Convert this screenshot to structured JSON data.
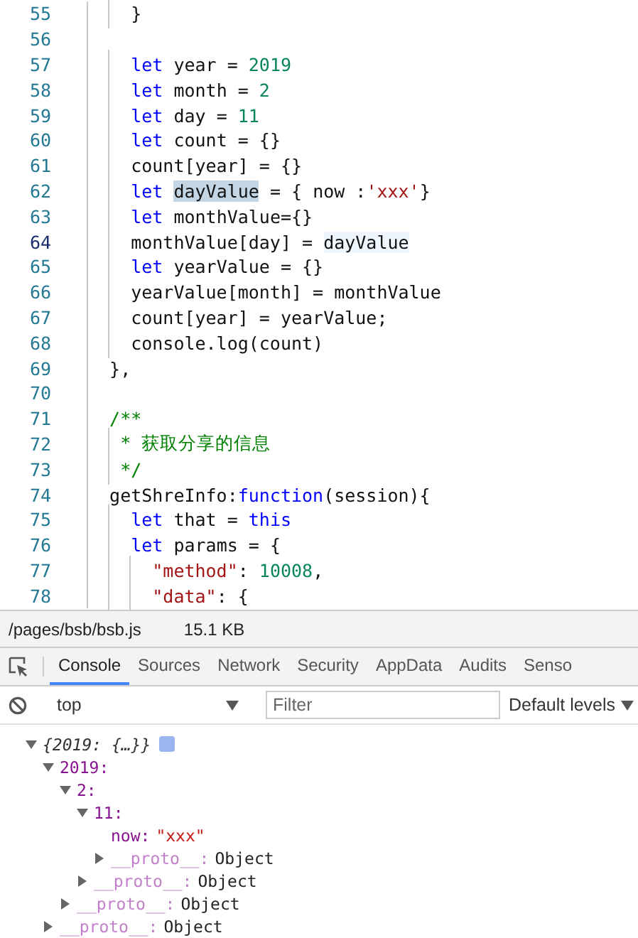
{
  "editor": {
    "lines": [
      {
        "number": "55",
        "current": false,
        "tokens": [
          {
            "kind": "plain",
            "text": "    }"
          }
        ]
      },
      {
        "number": "56",
        "current": false
      },
      {
        "number": "57",
        "current": false,
        "tokens": [
          {
            "kind": "keyword",
            "text": "    let"
          },
          {
            "kind": "plain",
            "text": " year = "
          },
          {
            "kind": "number",
            "text": "2019"
          }
        ]
      },
      {
        "number": "58",
        "current": false,
        "tokens": [
          {
            "kind": "keyword",
            "text": "    let"
          },
          {
            "kind": "plain",
            "text": " month = "
          },
          {
            "kind": "number",
            "text": "2"
          }
        ]
      },
      {
        "number": "59",
        "current": false,
        "tokens": [
          {
            "kind": "keyword",
            "text": "    let"
          },
          {
            "kind": "plain",
            "text": " day = "
          },
          {
            "kind": "number",
            "text": "11"
          }
        ]
      },
      {
        "number": "60",
        "current": false,
        "tokens": [
          {
            "kind": "keyword",
            "text": "    let"
          },
          {
            "kind": "plain",
            "text": " count = {}"
          }
        ]
      },
      {
        "number": "61",
        "current": false,
        "tokens": [
          {
            "kind": "plain",
            "text": "    count[year] = {}"
          }
        ]
      },
      {
        "number": "62",
        "current": false,
        "tokens": [
          {
            "kind": "keyword",
            "text": "    let "
          },
          {
            "kind": "selection",
            "text": "dayValue"
          },
          {
            "kind": "plain",
            "text": " = { now :"
          },
          {
            "kind": "string",
            "text": "'xxx'"
          },
          {
            "kind": "plain",
            "text": "}"
          }
        ]
      },
      {
        "number": "63",
        "current": false,
        "tokens": [
          {
            "kind": "keyword",
            "text": "    let"
          },
          {
            "kind": "plain",
            "text": " monthValue={}"
          }
        ]
      },
      {
        "number": "64",
        "current": true,
        "tokens": [
          {
            "kind": "plain",
            "text": "    monthValue[day] = "
          },
          {
            "kind": "match",
            "text": "dayValue"
          }
        ]
      },
      {
        "number": "65",
        "current": false,
        "tokens": [
          {
            "kind": "keyword",
            "text": "    let"
          },
          {
            "kind": "plain",
            "text": " yearValue = {}"
          }
        ]
      },
      {
        "number": "66",
        "current": false,
        "tokens": [
          {
            "kind": "plain",
            "text": "    yearValue[month] = monthValue"
          }
        ]
      },
      {
        "number": "67",
        "current": false,
        "tokens": [
          {
            "kind": "plain",
            "text": "    count[year] = yearValue;"
          }
        ]
      },
      {
        "number": "68",
        "current": false,
        "tokens": [
          {
            "kind": "plain",
            "text": "    console.log(count)"
          }
        ]
      },
      {
        "number": "69",
        "current": false,
        "tokens": [
          {
            "kind": "plain",
            "text": "  },"
          }
        ]
      },
      {
        "number": "70",
        "current": false
      },
      {
        "number": "71",
        "current": false,
        "tokens": [
          {
            "kind": "comment",
            "text": "  /**"
          }
        ]
      },
      {
        "number": "72",
        "current": false,
        "tokens": [
          {
            "kind": "comment",
            "text": "   * 获取分享的信息"
          }
        ]
      },
      {
        "number": "73",
        "current": false,
        "tokens": [
          {
            "kind": "comment",
            "text": "   */"
          }
        ]
      },
      {
        "number": "74",
        "current": false,
        "tokens": [
          {
            "kind": "plain",
            "text": "  getShreInfo:"
          },
          {
            "kind": "keyword",
            "text": "function"
          },
          {
            "kind": "plain",
            "text": "(session){"
          }
        ]
      },
      {
        "number": "75",
        "current": false,
        "tokens": [
          {
            "kind": "keyword",
            "text": "    let"
          },
          {
            "kind": "plain",
            "text": " that = "
          },
          {
            "kind": "keyword",
            "text": "this"
          }
        ]
      },
      {
        "number": "76",
        "current": false,
        "tokens": [
          {
            "kind": "keyword",
            "text": "    let"
          },
          {
            "kind": "plain",
            "text": " params = {"
          }
        ]
      },
      {
        "number": "77",
        "current": false,
        "tokens": [
          {
            "kind": "string",
            "text": "      \"method\""
          },
          {
            "kind": "plain",
            "text": ": "
          },
          {
            "kind": "number",
            "text": "10008"
          },
          {
            "kind": "plain",
            "text": ","
          }
        ]
      },
      {
        "number": "78",
        "current": false,
        "tokens": [
          {
            "kind": "string",
            "text": "      \"data\""
          },
          {
            "kind": "plain",
            "text": ": {"
          }
        ]
      }
    ]
  },
  "status_bar": {
    "file": "/pages/bsb/bsb.js",
    "size": "15.1 KB"
  },
  "devtools_tabs": [
    {
      "label": "Console",
      "selected": true
    },
    {
      "label": "Sources",
      "selected": false
    },
    {
      "label": "Network",
      "selected": false
    },
    {
      "label": "Security",
      "selected": false
    },
    {
      "label": "AppData",
      "selected": false
    },
    {
      "label": "Audits",
      "selected": false
    },
    {
      "label": "Senso",
      "selected": false
    }
  ],
  "console_toolbar": {
    "context": "top",
    "filter": {
      "placeholder": "Filter"
    },
    "levels": "Default levels"
  },
  "console_output": [
    {
      "kind": "summary",
      "text": "{2019: {…}}",
      "expanded": true,
      "children": [
        {
          "kind": "object",
          "key": "2019:",
          "expanded": true,
          "children": [
            {
              "kind": "object",
              "key": "2:",
              "expanded": true,
              "children": [
                {
                  "kind": "object",
                  "key": "11:",
                  "expanded": true,
                  "children": [
                    {
                      "kind": "string",
                      "key": "now:",
                      "value": "\"xxx\""
                    },
                    {
                      "kind": "proto",
                      "key": "__proto__:",
                      "value": "Object",
                      "expanded": false
                    }
                  ]
                },
                {
                  "kind": "proto",
                  "key": "__proto__:",
                  "value": "Object",
                  "expanded": false
                }
              ]
            },
            {
              "kind": "proto",
              "key": "__proto__:",
              "value": "Object",
              "expanded": false
            }
          ]
        },
        {
          "kind": "proto",
          "key": "__proto__:",
          "value": "Object",
          "expanded": false
        }
      ]
    }
  ]
}
